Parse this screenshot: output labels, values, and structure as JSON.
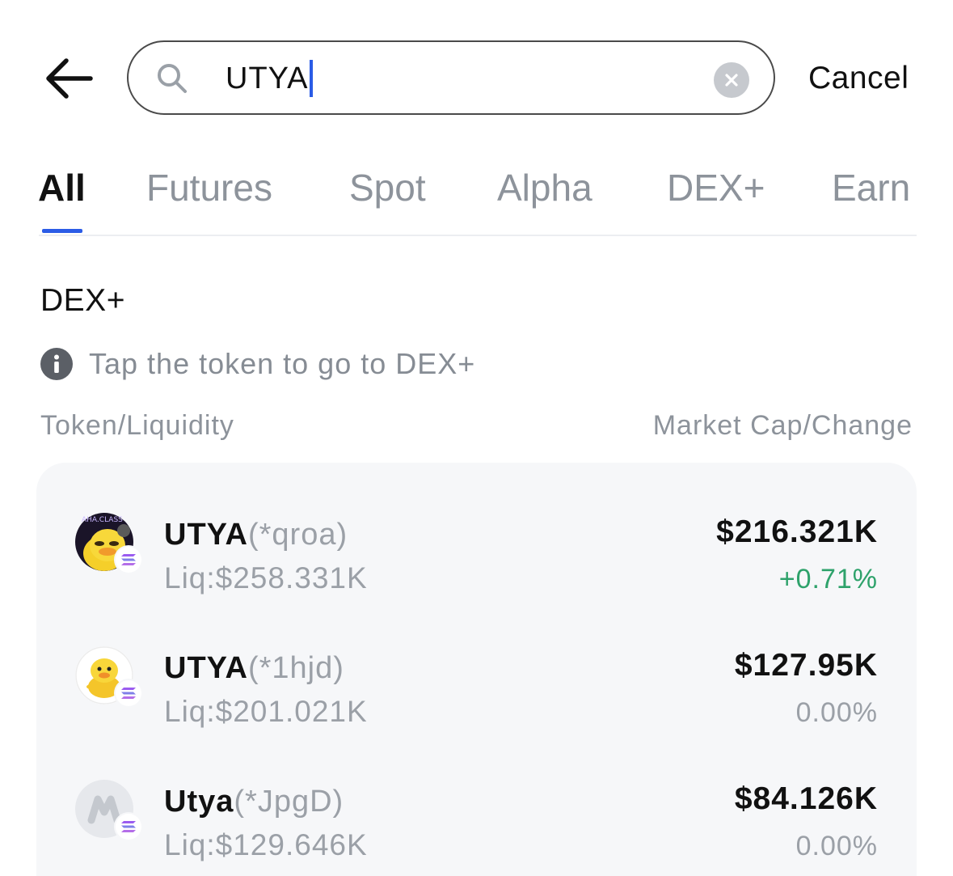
{
  "search": {
    "query": "UTYA",
    "cancel_label": "Cancel"
  },
  "tabs": [
    {
      "label": "All",
      "active": true
    },
    {
      "label": "Futures",
      "active": false
    },
    {
      "label": "Spot",
      "active": false
    },
    {
      "label": "Alpha",
      "active": false
    },
    {
      "label": "DEX+",
      "active": false
    },
    {
      "label": "Earn",
      "active": false
    }
  ],
  "section": {
    "title": "DEX+",
    "info_text": "Tap the token to go to DEX+",
    "col_left": "Token/Liquidity",
    "col_right": "Market Cap/Change"
  },
  "tokens": [
    {
      "symbol": "UTYA",
      "address": "(*qroa)",
      "liquidity": "Liq:$258.331K",
      "market_cap": "$216.321K",
      "change": "+0.71%",
      "change_color": "#2ea26b",
      "avatar": "duck-avatar-dark",
      "avatar_text": "AHA.CLASS"
    },
    {
      "symbol": "UTYA",
      "address": "(*1hjd)",
      "liquidity": "Liq:$201.021K",
      "market_cap": "$127.95K",
      "change": "0.00%",
      "change_color": "#9ba0a7",
      "avatar": "duck-avatar-light"
    },
    {
      "symbol": "Utya",
      "address": "(*JpgD)",
      "liquidity": "Liq:$129.646K",
      "market_cap": "$84.126K",
      "change": "0.00%",
      "change_color": "#9ba0a7",
      "avatar": "placeholder-token-avatar"
    }
  ],
  "colors": {
    "accent": "#2b5ce6",
    "positive": "#2ea26b",
    "muted": "#9ba0a7",
    "card_bg": "#f6f7f9"
  }
}
